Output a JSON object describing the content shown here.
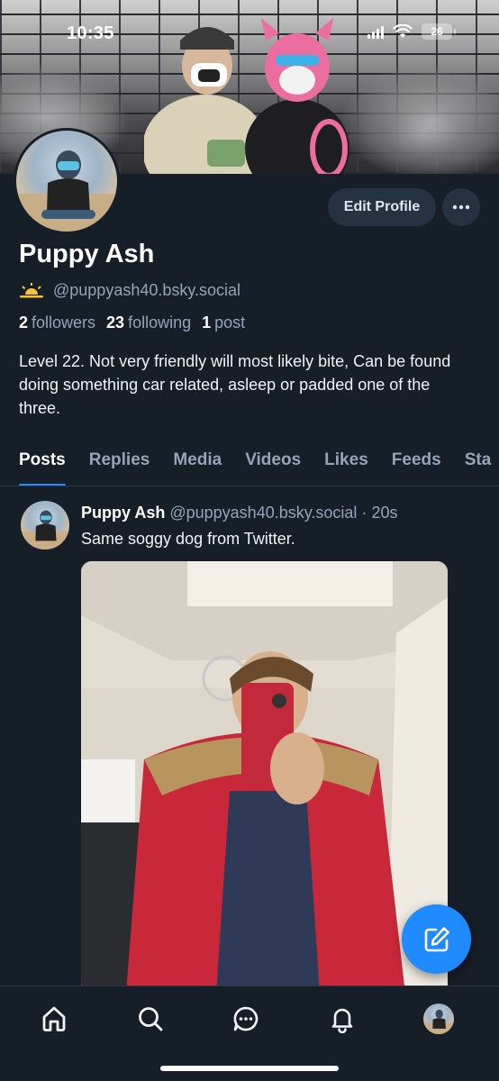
{
  "status_bar": {
    "time": "10:35",
    "battery": "26"
  },
  "profile": {
    "display_name": "Puppy Ash",
    "handle": "@puppyash40.bsky.social",
    "edit_button": "Edit Profile",
    "stats": {
      "followers_count": "2",
      "followers_label": "followers",
      "following_count": "23",
      "following_label": "following",
      "posts_count": "1",
      "posts_label": "post"
    },
    "bio": "Level 22. Not very friendly will most likely bite, Can be found doing something car related, asleep or padded one of the three."
  },
  "tabs": [
    "Posts",
    "Replies",
    "Media",
    "Videos",
    "Likes",
    "Feeds",
    "Sta"
  ],
  "active_tab": "Posts",
  "post": {
    "author": "Puppy Ash",
    "handle": "@puppyash40.bsky.social",
    "separator": "·",
    "time": "20s",
    "text": "Same soggy dog from Twitter."
  },
  "colors": {
    "background": "#161e27",
    "accent": "#208bfe",
    "muted_text": "#93a5b7",
    "button_bg": "#253241"
  },
  "icons": {
    "nav": [
      "home-icon",
      "search-icon",
      "chat-icon",
      "bell-icon",
      "profile-avatar"
    ],
    "fab": "compose-icon",
    "more": "ellipsis-icon",
    "handle_emoji": "sunrise-icon"
  }
}
